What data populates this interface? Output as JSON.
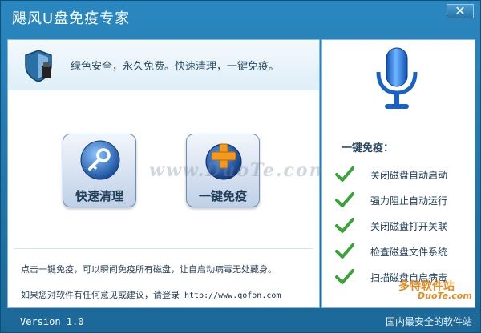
{
  "window": {
    "title": "飓风U盘免疫专家",
    "close_label": "✕"
  },
  "banner": {
    "slogan": "绿色安全，永久免费。快速清理，一键免疫。"
  },
  "actions": {
    "quick_clean": "快速清理",
    "one_click_immune": "一键免疫"
  },
  "watermark": {
    "text": "www.DuoTe.com"
  },
  "info": {
    "tip": "点击一键免疫，可以瞬间免疫所有磁盘，让自启动病毒无处藏身。",
    "contact_prefix": "如果您对软件有任何意见或建议，请登录",
    "contact_url": "http://www.qofon.com"
  },
  "immune_panel": {
    "title": "一键免疫：",
    "features": [
      {
        "label": "关闭磁盘自动启动"
      },
      {
        "label": "强力阻止自动运行"
      },
      {
        "label": "关闭磁盘打开关联"
      },
      {
        "label": "检查磁盘文件系统"
      },
      {
        "label": "扫描磁盘自启病毒"
      }
    ]
  },
  "footer": {
    "version": "Version 1.0",
    "site_logo": "多特软件站",
    "site_logo_sub": "DuoTe.com",
    "site_slogan": "国内最安全的软件站"
  },
  "colors": {
    "accent": "#2b87c0",
    "check_green": "#3aa33a",
    "mic_blue": "#1e6fd0"
  },
  "icons": {
    "shield": "shield-icon",
    "quick": "magnifier-key-icon",
    "immune": "globe-plus-icon",
    "mic": "microphone-icon",
    "check": "checkmark-icon"
  }
}
